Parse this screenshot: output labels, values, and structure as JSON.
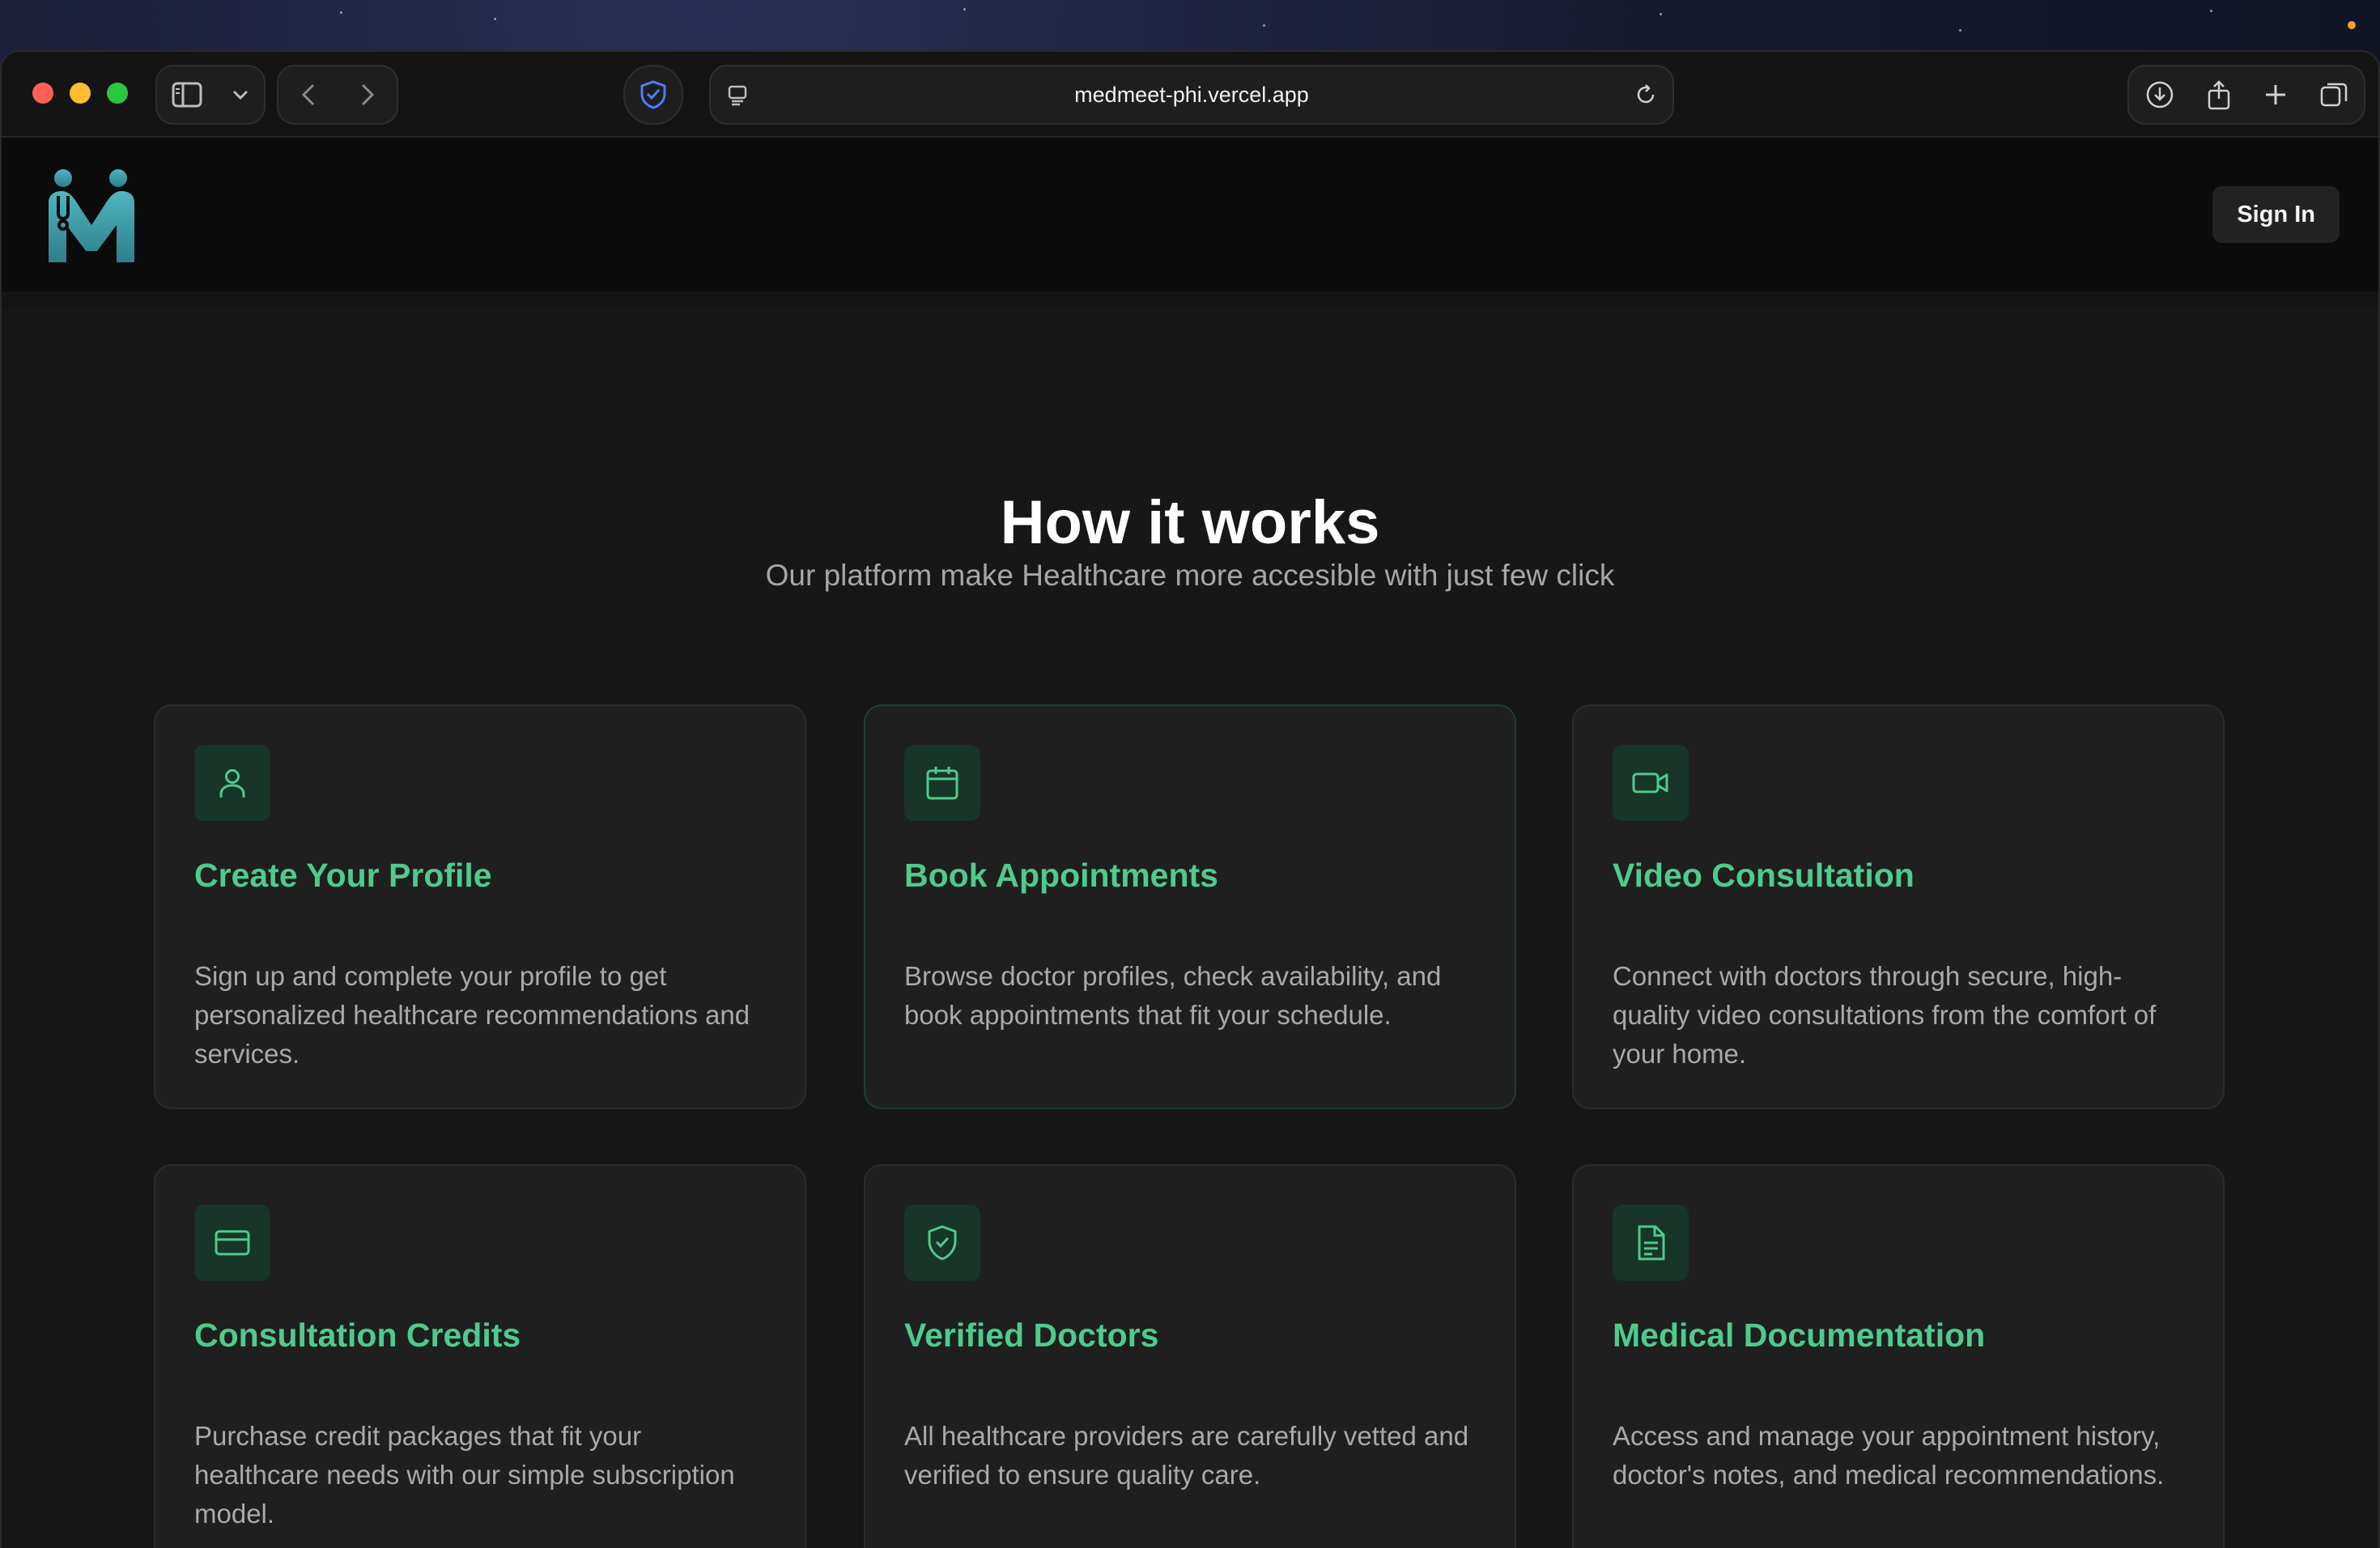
{
  "browser": {
    "url": "medmeet-phi.vercel.app"
  },
  "header": {
    "logo_alt": "M",
    "signin_label": "Sign In"
  },
  "hero": {
    "title": "How it works",
    "subtitle": "Our platform make Healthcare more accesible with just few click"
  },
  "features": [
    {
      "icon": "user-icon",
      "title": "Create Your Profile",
      "description": "Sign up and complete your profile to get personalized healthcare recommendations and services."
    },
    {
      "icon": "calendar-icon",
      "title": "Book Appointments",
      "description": "Browse doctor profiles, check availability, and book appointments that fit your schedule."
    },
    {
      "icon": "video-icon",
      "title": "Video Consultation",
      "description": "Connect with doctors through secure, high-quality video consultations from the comfort of your home."
    },
    {
      "icon": "credit-card-icon",
      "title": "Consultation Credits",
      "description": "Purchase credit packages that fit your healthcare needs with our simple subscription model."
    },
    {
      "icon": "shield-check-icon",
      "title": "Verified Doctors",
      "description": "All healthcare providers are carefully vetted and verified to ensure quality care."
    },
    {
      "icon": "document-icon",
      "title": "Medical Documentation",
      "description": "Access and manage your appointment history, doctor's notes, and medical recommendations."
    }
  ],
  "colors": {
    "accent": "#4ecb8d",
    "icon_bg": "#173528",
    "card_bg": "#1f1f1f",
    "page_bg": "#171717"
  }
}
